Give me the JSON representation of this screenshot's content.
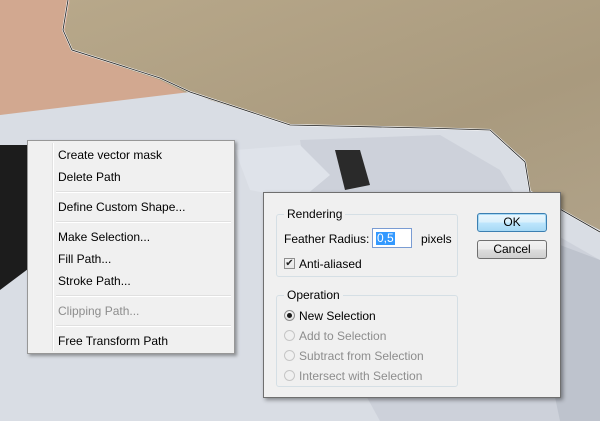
{
  "context_menu": {
    "items": [
      {
        "label": "Create vector mask",
        "enabled": true
      },
      {
        "label": "Delete Path",
        "enabled": true
      },
      {
        "label": "Define Custom Shape...",
        "enabled": true
      },
      {
        "label": "Make Selection...",
        "enabled": true
      },
      {
        "label": "Fill Path...",
        "enabled": true
      },
      {
        "label": "Stroke Path...",
        "enabled": true
      },
      {
        "label": "Clipping Path...",
        "enabled": false
      },
      {
        "label": "Free Transform Path",
        "enabled": true
      }
    ]
  },
  "dialog": {
    "rendering": {
      "title": "Rendering",
      "feather_label": "Feather Radius:",
      "feather_value": "0,5",
      "feather_unit": "pixels",
      "antialiased_label": "Anti-aliased",
      "antialiased_checked": true
    },
    "operation": {
      "title": "Operation",
      "options": [
        {
          "label": "New Selection",
          "selected": true,
          "enabled": true
        },
        {
          "label": "Add to Selection",
          "selected": false,
          "enabled": false
        },
        {
          "label": "Subtract from Selection",
          "selected": false,
          "enabled": false
        },
        {
          "label": "Intersect with Selection",
          "selected": false,
          "enabled": false
        }
      ]
    },
    "ok_label": "OK",
    "cancel_label": "Cancel"
  }
}
